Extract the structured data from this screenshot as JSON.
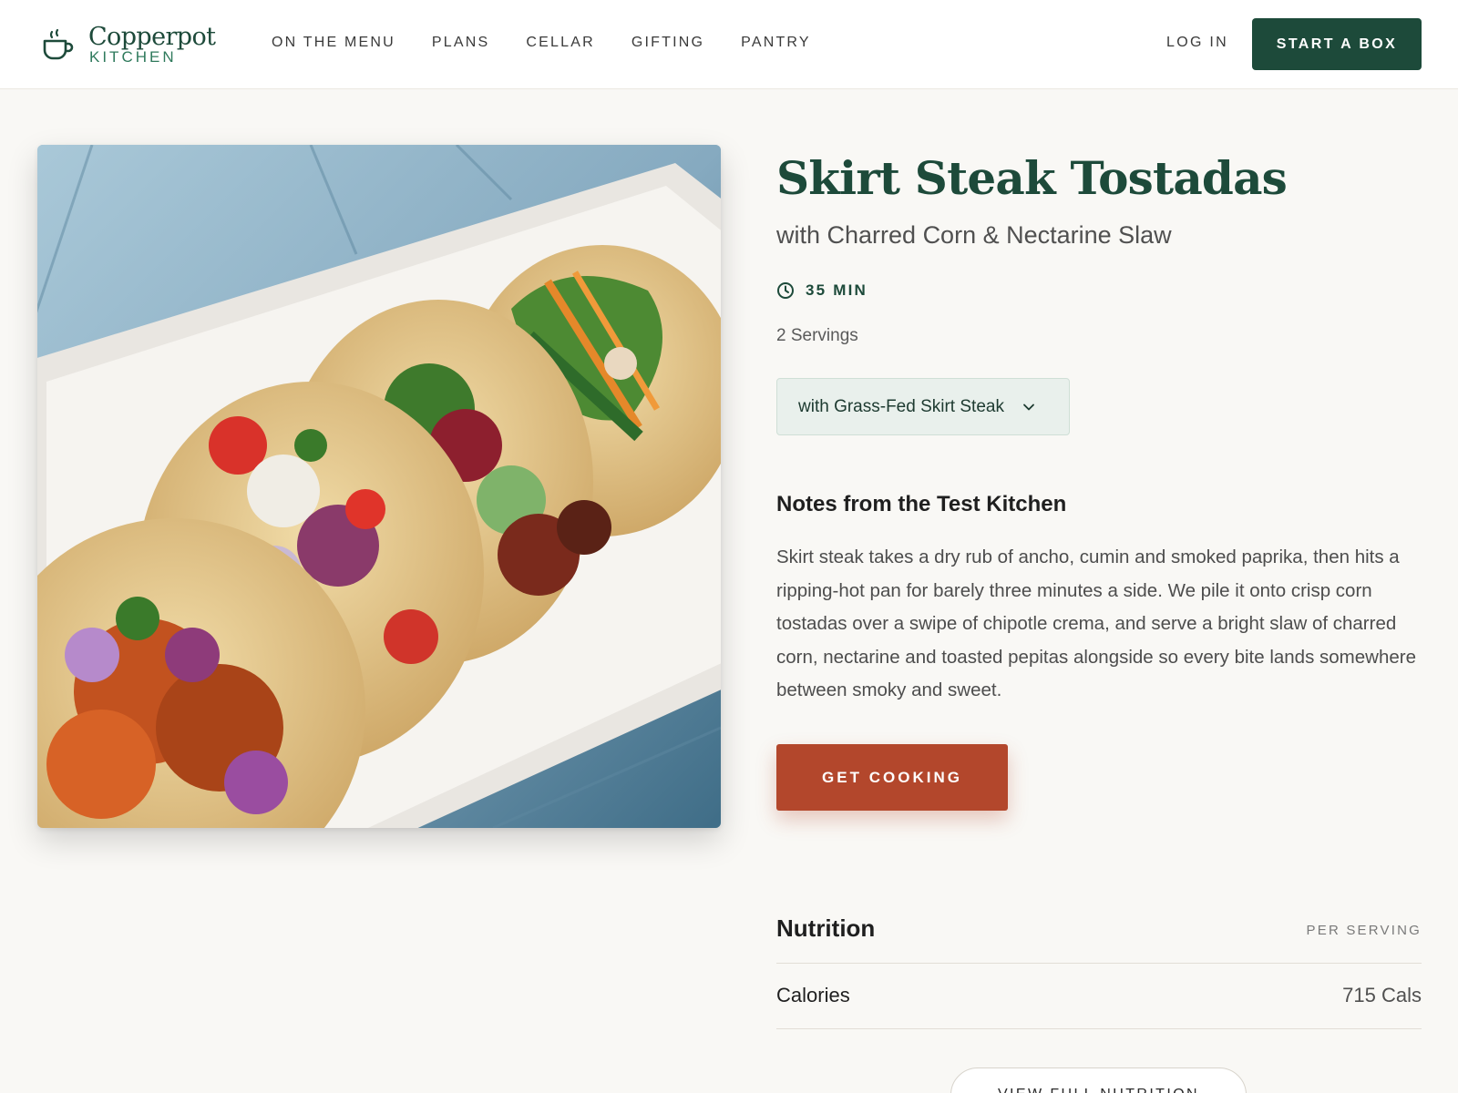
{
  "brand": {
    "name": "Copperpot",
    "sub": "KITCHEN",
    "icon": "coffee-cup-icon"
  },
  "nav": {
    "items": [
      "ON THE MENU",
      "PLANS",
      "CELLAR",
      "GIFTING",
      "PANTRY"
    ],
    "login_label": "LOG IN",
    "cta_label": "START A BOX"
  },
  "recipe": {
    "title": "Skirt Steak Tostadas",
    "subtitle": "with Charred Corn & Nectarine Slaw",
    "time": "35 MIN",
    "time_icon": "clock-icon",
    "servings": "2 Servings",
    "variant": "with Grass-Fed Skirt Steak",
    "notes_heading": "Notes from the Test Kitchen",
    "notes_body": "Skirt steak takes a dry rub of ancho, cumin and smoked paprika, then hits a ripping-hot pan for barely three minutes a side. We pile it onto crisp corn tostadas over a swipe of chipotle crema, and serve a bright slaw of charred corn, nectarine and toasted pepitas alongside so every bite lands somewhere between smoky and sweet.",
    "cta_label": "GET COOKING"
  },
  "nutrition": {
    "heading": "Nutrition",
    "per_serving": "PER SERVING",
    "rows": [
      {
        "label": "Calories",
        "value": "715 Cals"
      }
    ],
    "full_label": "VIEW FULL NUTRITION"
  },
  "colors": {
    "brand_green": "#1d4a3a",
    "accent_rust": "#b3472c",
    "page_bg": "#f9f8f5"
  }
}
